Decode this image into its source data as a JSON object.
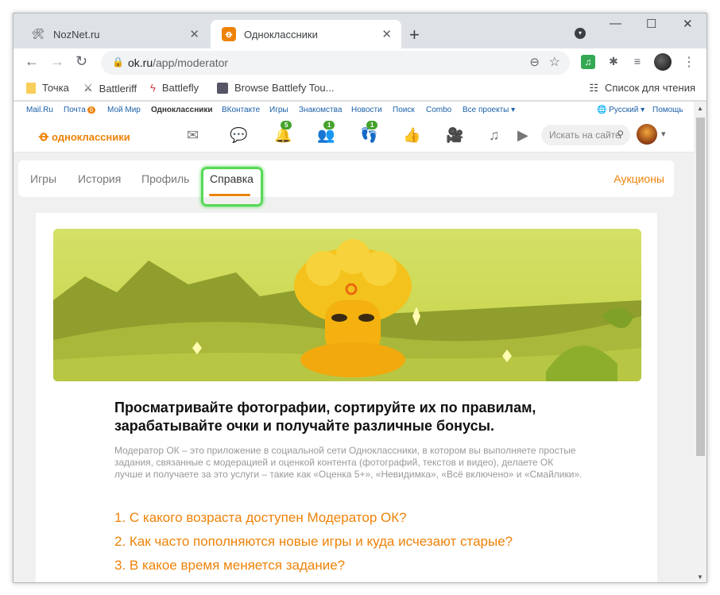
{
  "browser": {
    "tabs": [
      {
        "title": "NozNet.ru",
        "icon": "tools-icon"
      },
      {
        "title": "Одноклассники",
        "icon": "ok-icon"
      }
    ],
    "url_host": "ok.ru",
    "url_path": "/app/moderator",
    "bookmarks": [
      "Точка",
      "Battleriff",
      "Battlefly",
      "Browse Battlefy Tou..."
    ],
    "reading_list": "Список для чтения"
  },
  "ok": {
    "top_links": [
      "Mail.Ru",
      "Почта",
      "Мой Мир",
      "Одноклассники",
      "ВКонтакте",
      "Игры",
      "Знакомства",
      "Новости",
      "Поиск",
      "Combo",
      "Все проекты ▾"
    ],
    "mail_badge": "6",
    "language": "Русский ▾",
    "help": "Помощь",
    "logo": "одноклассники",
    "badges": {
      "notifications": "5",
      "friends": "1",
      "guests": "1"
    },
    "search_placeholder": "Искать на сайте"
  },
  "app": {
    "tabs": [
      "Игры",
      "История",
      "Профиль",
      "Справка"
    ],
    "active_tab": "Справка",
    "auctions": "Аукционы",
    "heading": "Просматривайте фотографии, сортируйте их по правилам, зарабатывайте очки и получайте различные бонусы.",
    "description": "Модератор ОК – это приложение в социальной сети Одноклассники, в котором вы выполняете простые задания, связанные с модерацией и оценкой контента (фотографий, текстов и видео), делаете ОК лучше и получаете за это услуги – такие как «Оценка 5+», «Невидимка», «Всё включено» и «Смайлики».",
    "faq": [
      "1. С какого возраста доступен Модератор ОК?",
      "2. Как часто пополняются новые игры и куда исчезают старые?",
      "3. В какое время меняется задание?"
    ]
  },
  "colors": {
    "accent": "#ee8208",
    "highlight": "#57d957",
    "badge": "#45a32d"
  }
}
